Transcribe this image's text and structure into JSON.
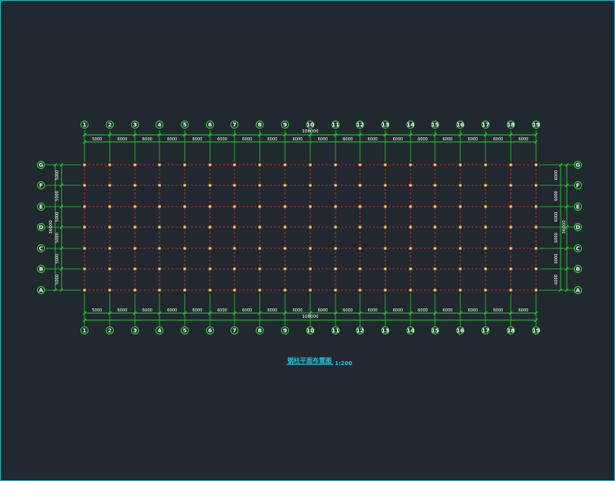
{
  "drawing": {
    "title": "钢柱平面布置图",
    "scale": "1:200",
    "total_length": "108000",
    "total_width": "36000",
    "x_axis_labels": [
      "1",
      "2",
      "3",
      "4",
      "5",
      "6",
      "7",
      "8",
      "9",
      "10",
      "11",
      "12",
      "13",
      "14",
      "15",
      "16",
      "17",
      "18",
      "19"
    ],
    "y_axis_labels": [
      "G",
      "F",
      "E",
      "D",
      "C",
      "B",
      "A"
    ],
    "top_spans": [
      "5000",
      "6000",
      "6000",
      "6000",
      "6000",
      "6000",
      "6000",
      "6000",
      "6000",
      "6000",
      "6000",
      "6000",
      "6000",
      "6000",
      "6000",
      "6000",
      "6000",
      "6000"
    ],
    "bottom_spans": [
      "5000",
      "6000",
      "6000",
      "6000",
      "6000",
      "6000",
      "6000",
      "6000",
      "6000",
      "6000",
      "6000",
      "6000",
      "6000",
      "6000",
      "6000",
      "6000",
      "6000",
      "6000"
    ],
    "left_spans": [
      "5000",
      "5000",
      "5000",
      "5000",
      "5000",
      "5000"
    ],
    "right_spans": [
      "6000",
      "6000",
      "6000",
      "6000",
      "6000",
      "6000"
    ]
  },
  "colors": {
    "background": "#212830",
    "frame": "#17b9c9",
    "grid_line": "#e0272a",
    "dimension": "#22d02a",
    "column": "#f2d33a",
    "bubble": "#22d02a",
    "title": "#1ec8dc"
  }
}
